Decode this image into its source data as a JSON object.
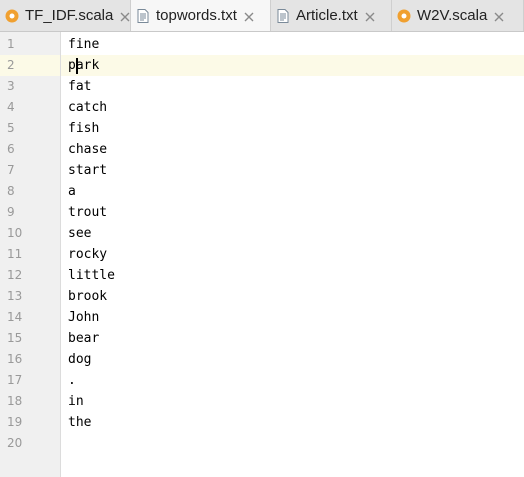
{
  "tabs": [
    {
      "label": "TF_IDF.scala",
      "icon": "scala-object-icon",
      "active": false
    },
    {
      "label": "topwords.txt",
      "icon": "text-file-icon",
      "active": true
    },
    {
      "label": "Article.txt",
      "icon": "text-file-icon",
      "active": false
    },
    {
      "label": "W2V.scala",
      "icon": "scala-object-icon",
      "active": false
    }
  ],
  "editor": {
    "current_line": 2,
    "line_numbers": [
      "1",
      "2",
      "3",
      "4",
      "5",
      "6",
      "7",
      "8",
      "9",
      "10",
      "11",
      "12",
      "13",
      "14",
      "15",
      "16",
      "17",
      "18",
      "19",
      "20"
    ],
    "lines": [
      "fine",
      "park",
      "fat",
      "catch",
      "fish",
      "chase",
      "start",
      "a",
      "trout",
      "see",
      "rocky",
      "little",
      "brook",
      "John",
      "bear",
      "dog",
      ".",
      "in",
      "the",
      ""
    ]
  },
  "colors": {
    "current_line_highlight": "#fcfae7",
    "gutter_background": "#f0f0f0",
    "scala_icon": "#f0a030",
    "line_number": "#999999"
  }
}
